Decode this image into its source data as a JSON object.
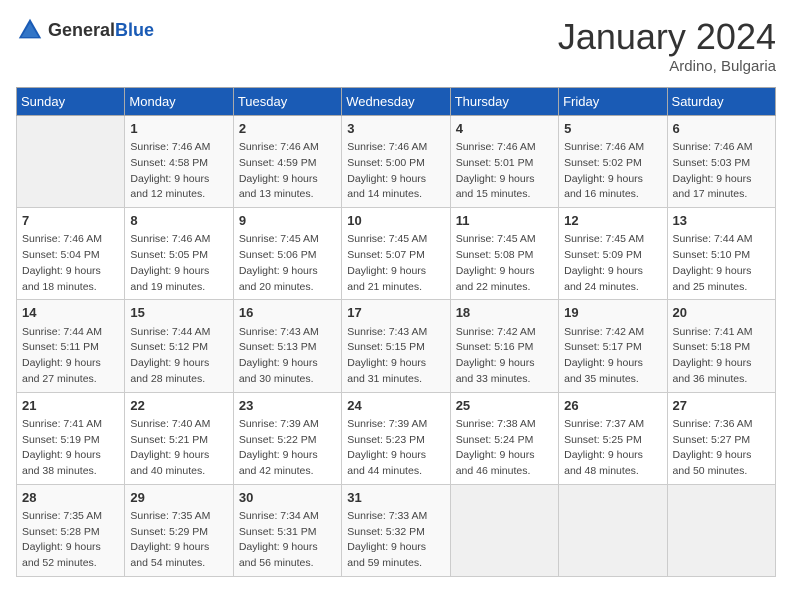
{
  "header": {
    "logo_general": "General",
    "logo_blue": "Blue",
    "month_title": "January 2024",
    "subtitle": "Ardino, Bulgaria"
  },
  "weekdays": [
    "Sunday",
    "Monday",
    "Tuesday",
    "Wednesday",
    "Thursday",
    "Friday",
    "Saturday"
  ],
  "weeks": [
    [
      {
        "day": "",
        "info": ""
      },
      {
        "day": "1",
        "info": "Sunrise: 7:46 AM\nSunset: 4:58 PM\nDaylight: 9 hours\nand 12 minutes."
      },
      {
        "day": "2",
        "info": "Sunrise: 7:46 AM\nSunset: 4:59 PM\nDaylight: 9 hours\nand 13 minutes."
      },
      {
        "day": "3",
        "info": "Sunrise: 7:46 AM\nSunset: 5:00 PM\nDaylight: 9 hours\nand 14 minutes."
      },
      {
        "day": "4",
        "info": "Sunrise: 7:46 AM\nSunset: 5:01 PM\nDaylight: 9 hours\nand 15 minutes."
      },
      {
        "day": "5",
        "info": "Sunrise: 7:46 AM\nSunset: 5:02 PM\nDaylight: 9 hours\nand 16 minutes."
      },
      {
        "day": "6",
        "info": "Sunrise: 7:46 AM\nSunset: 5:03 PM\nDaylight: 9 hours\nand 17 minutes."
      }
    ],
    [
      {
        "day": "7",
        "info": "Sunrise: 7:46 AM\nSunset: 5:04 PM\nDaylight: 9 hours\nand 18 minutes."
      },
      {
        "day": "8",
        "info": "Sunrise: 7:46 AM\nSunset: 5:05 PM\nDaylight: 9 hours\nand 19 minutes."
      },
      {
        "day": "9",
        "info": "Sunrise: 7:45 AM\nSunset: 5:06 PM\nDaylight: 9 hours\nand 20 minutes."
      },
      {
        "day": "10",
        "info": "Sunrise: 7:45 AM\nSunset: 5:07 PM\nDaylight: 9 hours\nand 21 minutes."
      },
      {
        "day": "11",
        "info": "Sunrise: 7:45 AM\nSunset: 5:08 PM\nDaylight: 9 hours\nand 22 minutes."
      },
      {
        "day": "12",
        "info": "Sunrise: 7:45 AM\nSunset: 5:09 PM\nDaylight: 9 hours\nand 24 minutes."
      },
      {
        "day": "13",
        "info": "Sunrise: 7:44 AM\nSunset: 5:10 PM\nDaylight: 9 hours\nand 25 minutes."
      }
    ],
    [
      {
        "day": "14",
        "info": "Sunrise: 7:44 AM\nSunset: 5:11 PM\nDaylight: 9 hours\nand 27 minutes."
      },
      {
        "day": "15",
        "info": "Sunrise: 7:44 AM\nSunset: 5:12 PM\nDaylight: 9 hours\nand 28 minutes."
      },
      {
        "day": "16",
        "info": "Sunrise: 7:43 AM\nSunset: 5:13 PM\nDaylight: 9 hours\nand 30 minutes."
      },
      {
        "day": "17",
        "info": "Sunrise: 7:43 AM\nSunset: 5:15 PM\nDaylight: 9 hours\nand 31 minutes."
      },
      {
        "day": "18",
        "info": "Sunrise: 7:42 AM\nSunset: 5:16 PM\nDaylight: 9 hours\nand 33 minutes."
      },
      {
        "day": "19",
        "info": "Sunrise: 7:42 AM\nSunset: 5:17 PM\nDaylight: 9 hours\nand 35 minutes."
      },
      {
        "day": "20",
        "info": "Sunrise: 7:41 AM\nSunset: 5:18 PM\nDaylight: 9 hours\nand 36 minutes."
      }
    ],
    [
      {
        "day": "21",
        "info": "Sunrise: 7:41 AM\nSunset: 5:19 PM\nDaylight: 9 hours\nand 38 minutes."
      },
      {
        "day": "22",
        "info": "Sunrise: 7:40 AM\nSunset: 5:21 PM\nDaylight: 9 hours\nand 40 minutes."
      },
      {
        "day": "23",
        "info": "Sunrise: 7:39 AM\nSunset: 5:22 PM\nDaylight: 9 hours\nand 42 minutes."
      },
      {
        "day": "24",
        "info": "Sunrise: 7:39 AM\nSunset: 5:23 PM\nDaylight: 9 hours\nand 44 minutes."
      },
      {
        "day": "25",
        "info": "Sunrise: 7:38 AM\nSunset: 5:24 PM\nDaylight: 9 hours\nand 46 minutes."
      },
      {
        "day": "26",
        "info": "Sunrise: 7:37 AM\nSunset: 5:25 PM\nDaylight: 9 hours\nand 48 minutes."
      },
      {
        "day": "27",
        "info": "Sunrise: 7:36 AM\nSunset: 5:27 PM\nDaylight: 9 hours\nand 50 minutes."
      }
    ],
    [
      {
        "day": "28",
        "info": "Sunrise: 7:35 AM\nSunset: 5:28 PM\nDaylight: 9 hours\nand 52 minutes."
      },
      {
        "day": "29",
        "info": "Sunrise: 7:35 AM\nSunset: 5:29 PM\nDaylight: 9 hours\nand 54 minutes."
      },
      {
        "day": "30",
        "info": "Sunrise: 7:34 AM\nSunset: 5:31 PM\nDaylight: 9 hours\nand 56 minutes."
      },
      {
        "day": "31",
        "info": "Sunrise: 7:33 AM\nSunset: 5:32 PM\nDaylight: 9 hours\nand 59 minutes."
      },
      {
        "day": "",
        "info": ""
      },
      {
        "day": "",
        "info": ""
      },
      {
        "day": "",
        "info": ""
      }
    ]
  ]
}
